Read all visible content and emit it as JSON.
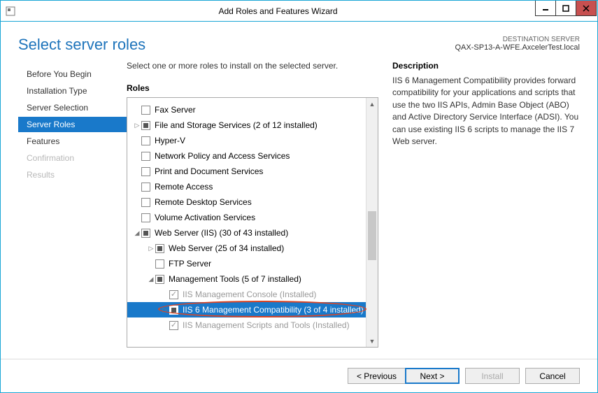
{
  "window": {
    "title": "Add Roles and Features Wizard"
  },
  "header": {
    "title": "Select server roles",
    "dest_label": "DESTINATION SERVER",
    "dest_server": "QAX-SP13-A-WFE.AxcelerTest.local"
  },
  "nav": {
    "items": [
      {
        "label": "Before You Begin",
        "state": "normal"
      },
      {
        "label": "Installation Type",
        "state": "normal"
      },
      {
        "label": "Server Selection",
        "state": "normal"
      },
      {
        "label": "Server Roles",
        "state": "active"
      },
      {
        "label": "Features",
        "state": "normal"
      },
      {
        "label": "Confirmation",
        "state": "disabled"
      },
      {
        "label": "Results",
        "state": "disabled"
      }
    ]
  },
  "roles": {
    "instruction": "Select one or more roles to install on the selected server.",
    "section_label": "Roles",
    "tree": [
      {
        "indent": 0,
        "exp": "",
        "cb": "empty",
        "label": "Fax Server"
      },
      {
        "indent": 0,
        "exp": "▷",
        "cb": "partial",
        "label": "File and Storage Services (2 of 12 installed)"
      },
      {
        "indent": 0,
        "exp": "",
        "cb": "empty",
        "label": "Hyper-V"
      },
      {
        "indent": 0,
        "exp": "",
        "cb": "empty",
        "label": "Network Policy and Access Services"
      },
      {
        "indent": 0,
        "exp": "",
        "cb": "empty",
        "label": "Print and Document Services"
      },
      {
        "indent": 0,
        "exp": "",
        "cb": "empty",
        "label": "Remote Access"
      },
      {
        "indent": 0,
        "exp": "",
        "cb": "empty",
        "label": "Remote Desktop Services"
      },
      {
        "indent": 0,
        "exp": "",
        "cb": "empty",
        "label": "Volume Activation Services"
      },
      {
        "indent": 0,
        "exp": "◢",
        "cb": "partial",
        "label": "Web Server (IIS) (30 of 43 installed)"
      },
      {
        "indent": 1,
        "exp": "▷",
        "cb": "partial",
        "label": "Web Server (25 of 34 installed)"
      },
      {
        "indent": 1,
        "exp": "",
        "cb": "empty",
        "label": "FTP Server"
      },
      {
        "indent": 1,
        "exp": "◢",
        "cb": "partial",
        "label": "Management Tools (5 of 7 installed)"
      },
      {
        "indent": 2,
        "exp": "",
        "cb": "checked-dis",
        "label": "IIS Management Console (Installed)",
        "dis": true
      },
      {
        "indent": 2,
        "exp": "▷",
        "cb": "partial",
        "label": "IIS 6 Management Compatibility (3 of 4 installed)",
        "selected": true,
        "highlight": true
      },
      {
        "indent": 2,
        "exp": "",
        "cb": "checked-dis",
        "label": "IIS Management Scripts and Tools (Installed)",
        "dis": true
      }
    ]
  },
  "description": {
    "section_label": "Description",
    "text": "IIS 6 Management Compatibility provides forward compatibility for your applications and scripts that use the two IIS APIs, Admin Base Object (ABO) and Active Directory Service Interface (ADSI). You can use existing IIS 6 scripts to manage the IIS 7 Web server."
  },
  "footer": {
    "previous": "< Previous",
    "next": "Next >",
    "install": "Install",
    "cancel": "Cancel"
  }
}
